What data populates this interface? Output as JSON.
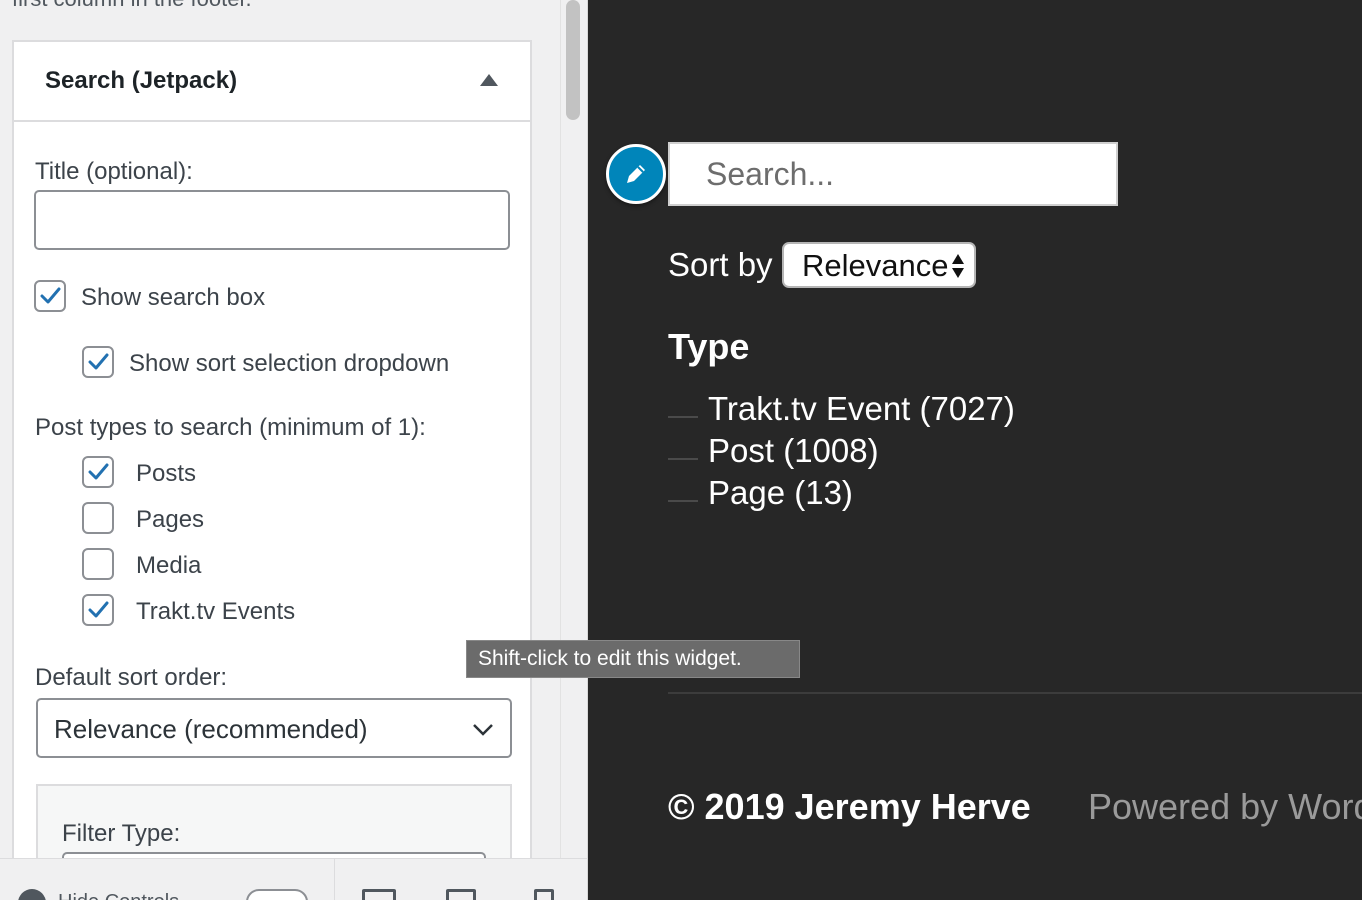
{
  "sidebar": {
    "cut_off_text": "first column in the footer.",
    "widget": {
      "title": "Search (Jetpack)",
      "title_field_label": "Title (optional):",
      "title_field_value": "",
      "show_search_box": {
        "label": "Show search box",
        "checked": true
      },
      "show_sort_dropdown": {
        "label": "Show sort selection dropdown",
        "checked": true
      },
      "post_types_label": "Post types to search (minimum of 1):",
      "post_types": [
        {
          "label": "Posts",
          "checked": true
        },
        {
          "label": "Pages",
          "checked": false
        },
        {
          "label": "Media",
          "checked": false
        },
        {
          "label": "Trakt.tv Events",
          "checked": true
        }
      ],
      "sort_order_label": "Default sort order:",
      "sort_order_value": "Relevance (recommended)",
      "filter_type_label": "Filter Type:"
    },
    "footer": {
      "hide_controls_label": "Hide Controls"
    }
  },
  "preview": {
    "search_placeholder": "Search...",
    "sort_by_label": "Sort by",
    "sort_by_value": "Relevance",
    "facet_heading": "Type",
    "facets": [
      {
        "label": "Trakt.tv Event (7027)"
      },
      {
        "label": "Post (1008)"
      },
      {
        "label": "Page (13)"
      }
    ],
    "tooltip": "Shift-click to edit this widget.",
    "copyright": "© 2019 Jeremy Herve",
    "powered_by": "Powered by WordPress"
  },
  "colors": {
    "accent": "#2271b1",
    "edit_button": "#0085ba",
    "preview_bg": "#272727",
    "panel_bg": "#f0f0f1"
  }
}
